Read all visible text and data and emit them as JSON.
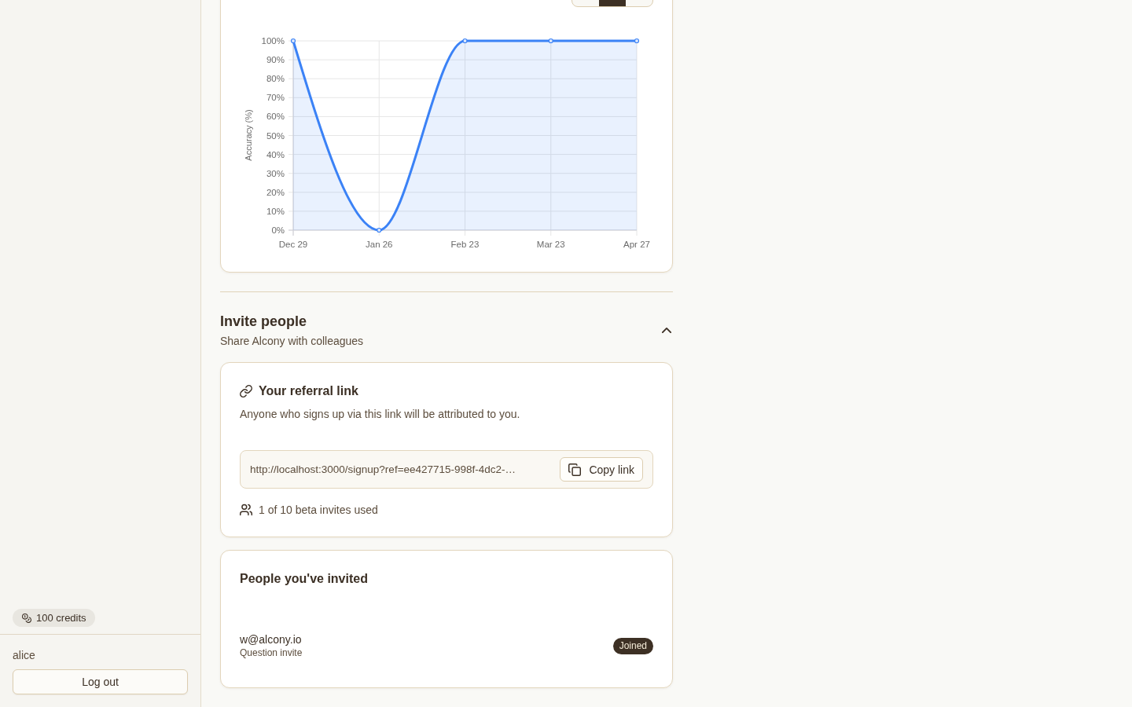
{
  "sidebar": {
    "credits": "100 credits",
    "user": "alice",
    "logout_button": "Log out"
  },
  "accuracy_card": {
    "range_tabs": [
      {
        "selected": false
      },
      {
        "selected": true
      },
      {
        "selected": false
      }
    ],
    "chart_data": {
      "type": "area",
      "ylabel": "Accuracy (%)",
      "categories": [
        "Dec 29",
        "Jan 26",
        "Feb 23",
        "Mar 23",
        "Apr 27"
      ],
      "series": [
        {
          "color": "#3b82f6",
          "values": [
            100,
            0,
            100,
            100,
            100
          ]
        }
      ],
      "ylim": [
        0,
        100
      ],
      "yticks": [
        {
          "value": 0,
          "label": "0%"
        },
        {
          "value": 10,
          "label": "10%"
        },
        {
          "value": 20,
          "label": "20%"
        },
        {
          "value": 30,
          "label": "30%"
        },
        {
          "value": 40,
          "label": "40%"
        },
        {
          "value": 50,
          "label": "50%"
        },
        {
          "value": 60,
          "label": "60%"
        },
        {
          "value": 70,
          "label": "70%"
        },
        {
          "value": 80,
          "label": "80%"
        },
        {
          "value": 90,
          "label": "90%"
        },
        {
          "value": 100,
          "label": "100%"
        }
      ],
      "grid": true
    }
  },
  "invite_section": {
    "title": "Invite people",
    "subtitle": "Share Alcony with colleagues",
    "expanded": true
  },
  "referral_card": {
    "title": "Your referral link",
    "description": "Anyone who signs up via this link will be attributed to you.",
    "link": "http://localhost:3000/signup?ref=ee427715-998f-4dc2-…",
    "copy_button": "Copy link",
    "usage": "1 of 10 beta invites used"
  },
  "invited_card": {
    "title": "People you've invited",
    "people": [
      {
        "email": "w@alcony.io",
        "source": "Question invite",
        "status": "Joined"
      }
    ]
  }
}
